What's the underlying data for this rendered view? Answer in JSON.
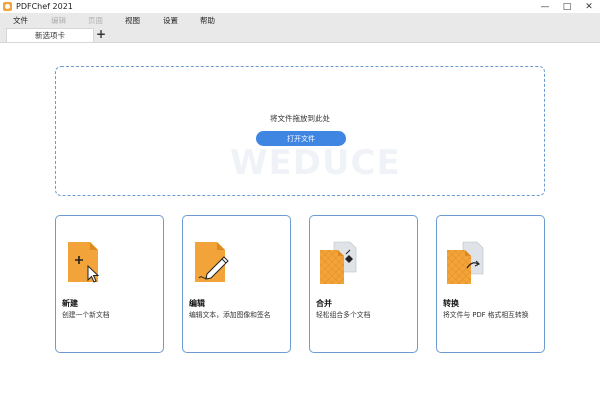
{
  "window": {
    "title": "PDFChef 2021",
    "minimize_glyph": "—",
    "maximize_glyph": "□",
    "close_glyph": "✕"
  },
  "menu": {
    "items": [
      {
        "label": "文件",
        "enabled": true
      },
      {
        "label": "编辑",
        "enabled": false
      },
      {
        "label": "页面",
        "enabled": false
      },
      {
        "label": "视图",
        "enabled": true
      },
      {
        "label": "设置",
        "enabled": true
      },
      {
        "label": "帮助",
        "enabled": true
      }
    ]
  },
  "tabs": {
    "items": [
      {
        "label": "新选项卡"
      }
    ],
    "add_glyph": "+"
  },
  "dropzone": {
    "text": "将文件拖放到此处",
    "open_button_label": "打开文件"
  },
  "watermark": "WEDUCE",
  "cards": [
    {
      "title": "新建",
      "desc": "创建一个新文档",
      "icon": "new-document-icon"
    },
    {
      "title": "编辑",
      "desc": "编辑文本，添加图像和签名",
      "icon": "edit-document-icon"
    },
    {
      "title": "合并",
      "desc": "轻松组合多个文档",
      "icon": "merge-documents-icon"
    },
    {
      "title": "转换",
      "desc": "将文件与 PDF 格式相互转换",
      "icon": "convert-document-icon"
    }
  ],
  "colors": {
    "accent": "#3f86e3",
    "card_border": "#6c9bd2",
    "doc_orange": "#f2a33a",
    "doc_orange_dark": "#e08a1c",
    "menubar_bg": "#e9e9e9"
  }
}
